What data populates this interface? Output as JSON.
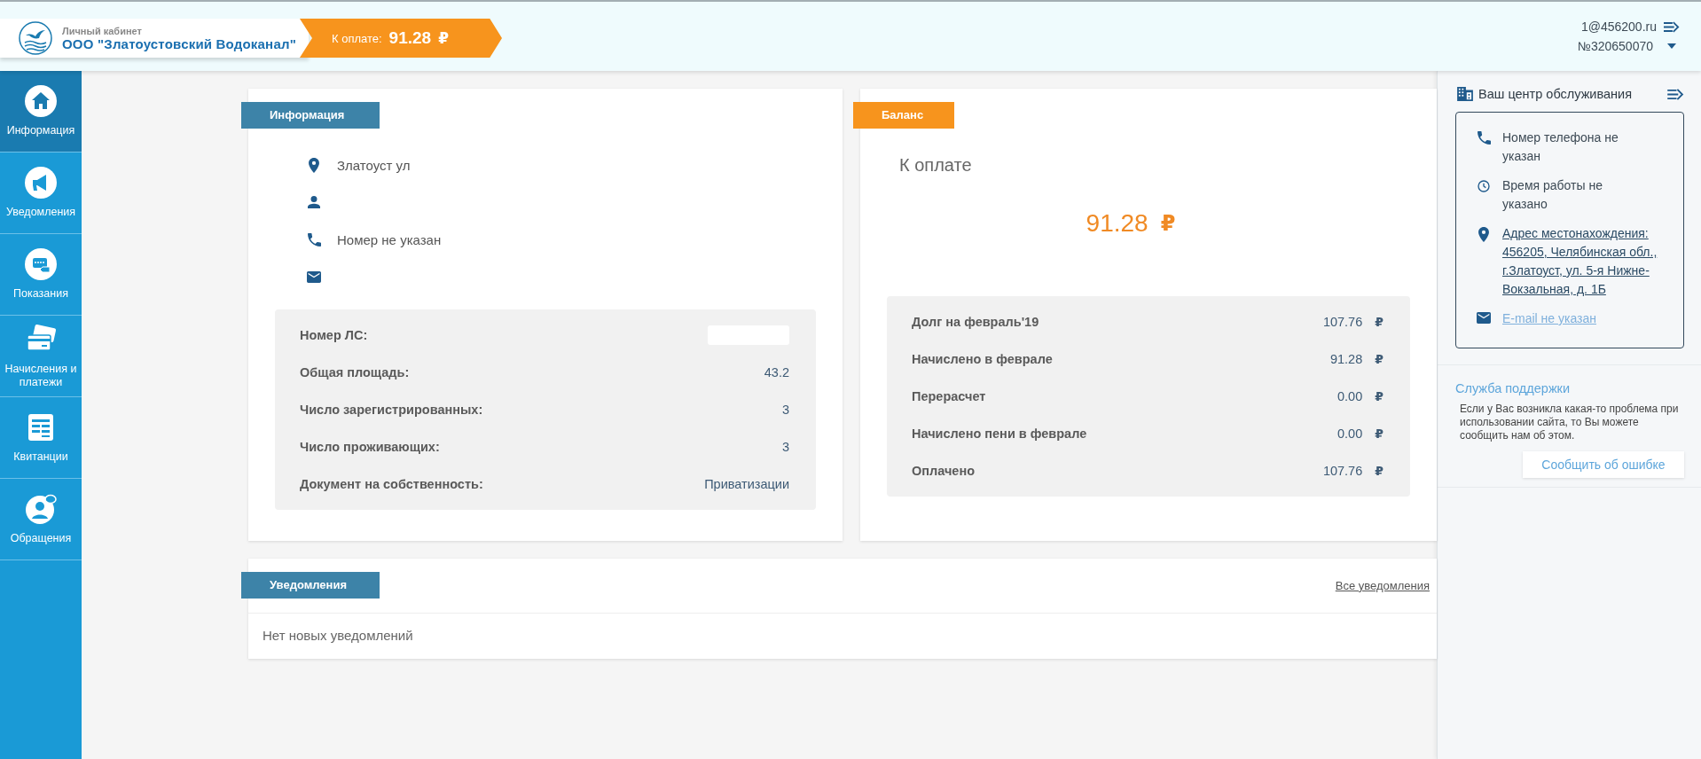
{
  "header": {
    "subtitle": "Личный кабинет",
    "company": "ООО \"Златоустовский Водоканал\"",
    "due_label": "К оплате:",
    "due_amount": "91.28",
    "currency": "₽",
    "account_email": "1@456200.ru",
    "account_number": "№320650070"
  },
  "sidebar": {
    "items": [
      {
        "label": "Информация",
        "kind": "home",
        "selected": true
      },
      {
        "label": "Уведомления",
        "kind": "megaphone",
        "selected": false
      },
      {
        "label": "Показания",
        "kind": "meter",
        "selected": false
      },
      {
        "label": "Начисления и платежи",
        "kind": "cards",
        "selected": false
      },
      {
        "label": "Квитанции",
        "kind": "receipt",
        "selected": false
      },
      {
        "label": "Обращения",
        "kind": "chat",
        "selected": false
      }
    ]
  },
  "info_card": {
    "title": "Информация",
    "contacts": [
      {
        "kind": "address",
        "text": "Златоуст ул"
      },
      {
        "kind": "person"
      },
      {
        "kind": "phone",
        "text": "Номер не указан"
      },
      {
        "kind": "email"
      }
    ],
    "details": [
      {
        "label": "Номер ЛС:",
        "kind": "blank"
      },
      {
        "label": "Общая площадь:",
        "kind": "text",
        "value": "43.2"
      },
      {
        "label": "Число зарегистрированных:",
        "kind": "text",
        "value": "3"
      },
      {
        "label": "Число проживающих:",
        "kind": "text",
        "value": "3"
      },
      {
        "label": "Документ на собственность:",
        "kind": "text",
        "value": "Приватизации"
      }
    ]
  },
  "balance_card": {
    "title": "Баланс",
    "due_label": "К оплате",
    "amount": "91.28",
    "currency": "₽",
    "rows": [
      {
        "label": "Долг на февраль'19",
        "value": "107.76",
        "currency": "₽"
      },
      {
        "label": "Начислено в феврале",
        "value": "91.28",
        "currency": "₽"
      },
      {
        "label": "Перерасчет",
        "value": "0.00",
        "currency": "₽"
      },
      {
        "label": "Начислено пени в феврале",
        "value": "0.00",
        "currency": "₽"
      },
      {
        "label": "Оплачено",
        "value": "107.76",
        "currency": "₽"
      }
    ]
  },
  "notifications": {
    "title": "Уведомления",
    "all_link": "Все уведомления",
    "empty_text": "Нет новых уведомлений"
  },
  "service_center": {
    "title": "Ваш центр обслуживания",
    "items": [
      {
        "kind": "phone",
        "text": "Номер телефона не указан",
        "link": false
      },
      {
        "kind": "clock",
        "text": "Время работы не указано",
        "link": false
      },
      {
        "kind": "address",
        "text": "Адрес местонахождения: 456205, Челябинская обл., г.Златоуст, ул. 5-я Нижне-Вокзальная, д. 1Б",
        "link": true
      },
      {
        "kind": "email",
        "text": "E-mail не указан",
        "link": true
      }
    ]
  },
  "support": {
    "title": "Служба поддержки",
    "text": "Если у Вас возникла какая-то проблема при использовании сайта, то Вы можете сообщить нам об этом.",
    "button": "Сообщить об ошибке"
  }
}
